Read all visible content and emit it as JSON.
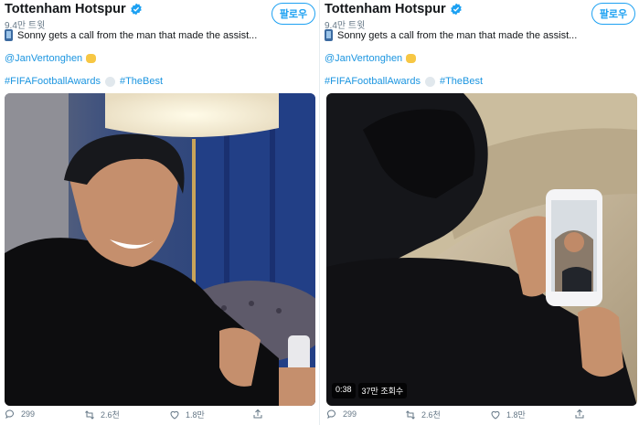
{
  "tweets": [
    {
      "account": {
        "name": "Tottenham Hotspur",
        "verified_icon": "verified-badge-icon",
        "stats": "9.4만 트윗"
      },
      "follow_label": "팔로우",
      "text": "Sonny gets a call from the man that made the assist...",
      "mention": "@JanVertonghen",
      "hashtags": [
        "#FIFAFootballAwards",
        "#TheBest"
      ],
      "media": {
        "kind": "video-still",
        "description_icon": "video-thumbnail"
      },
      "actions": {
        "reply": "299",
        "retweet": "2.6천",
        "like": "1.8만",
        "share": ""
      }
    },
    {
      "account": {
        "name": "Tottenham Hotspur",
        "verified_icon": "verified-badge-icon",
        "stats": "9.4만 트윗"
      },
      "follow_label": "팔로우",
      "text": "Sonny gets a call from the man that made the assist...",
      "mention": "@JanVertonghen",
      "hashtags": [
        "#FIFAFootballAwards",
        "#TheBest"
      ],
      "media": {
        "kind": "video-still",
        "duration": "0:38",
        "views": "37만 조회수"
      },
      "actions": {
        "reply": "299",
        "retweet": "2.6천",
        "like": "1.8만",
        "share": ""
      }
    }
  ],
  "colors": {
    "accent": "#1da1f2",
    "link": "#1b95e0",
    "text": "#14171a",
    "muted": "#657786"
  }
}
